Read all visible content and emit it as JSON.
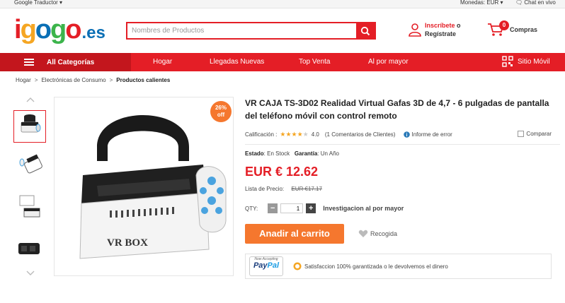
{
  "topbar": {
    "translator": "Google Traductor",
    "currency_label": "Monedas:",
    "currency_value": "EUR",
    "chat": "Chat en vivo"
  },
  "header": {
    "logo_letters": [
      "i",
      "g",
      "o",
      "g",
      "o"
    ],
    "logo_tld": ".es",
    "search_placeholder": "Nombres de Productos",
    "account_line1": "Inscríbete",
    "account_or": "o",
    "account_line2": "Regístrate",
    "cart_count": "0",
    "cart_label": "Compras"
  },
  "nav": {
    "categories": "All Categorías",
    "items": [
      "Hogar",
      "Llegadas Nuevas",
      "Top Venta",
      "Al por mayor"
    ],
    "mobile": "Sitio Móvil"
  },
  "breadcrumb": [
    "Hogar",
    "Electrónicas de Consumo",
    "Productos calientes"
  ],
  "gallery": {
    "discount_pct": "26%",
    "discount_word": "off",
    "main_brand": "VR BOX"
  },
  "product": {
    "title": "VR CAJA TS-3D02 Realidad Virtual Gafas 3D de 4,7 - 6 pulgadas de pantalla del teléfono móvil con control remoto",
    "rating_label": "Calificación :",
    "rating_value": "4.0",
    "rating_stars": 4,
    "reviews": "(1 Comentarios de Clientes)",
    "error_report": "Informe de error",
    "compare": "Comparar",
    "status_label": "Estado",
    "status_value": "En Stock",
    "warranty_label": "Garantía",
    "warranty_value": "Un Año",
    "price": "EUR € 12.62",
    "list_price_label": "Lista de Precio:",
    "list_price_value": "EUR €17.17",
    "qty_label": "QTY:",
    "qty_value": "1",
    "wholesale": "Investigacion al por mayor",
    "add_to_cart": "Anadir al carrito",
    "wishlist": "Recogida",
    "paypal_tagline": "Now Accepting",
    "paypal_word1": "Pay",
    "paypal_word2": "Pal",
    "satisfaction": "Satisfaccion 100%  garantizada o le devolvemos el dinero"
  },
  "colors": {
    "brand_red": "#e41e26",
    "accent_orange": "#f5772e",
    "logo_letters": [
      "#e41e26",
      "#f5a623",
      "#0a6fb5",
      "#3cb44b",
      "#e41e26"
    ]
  }
}
